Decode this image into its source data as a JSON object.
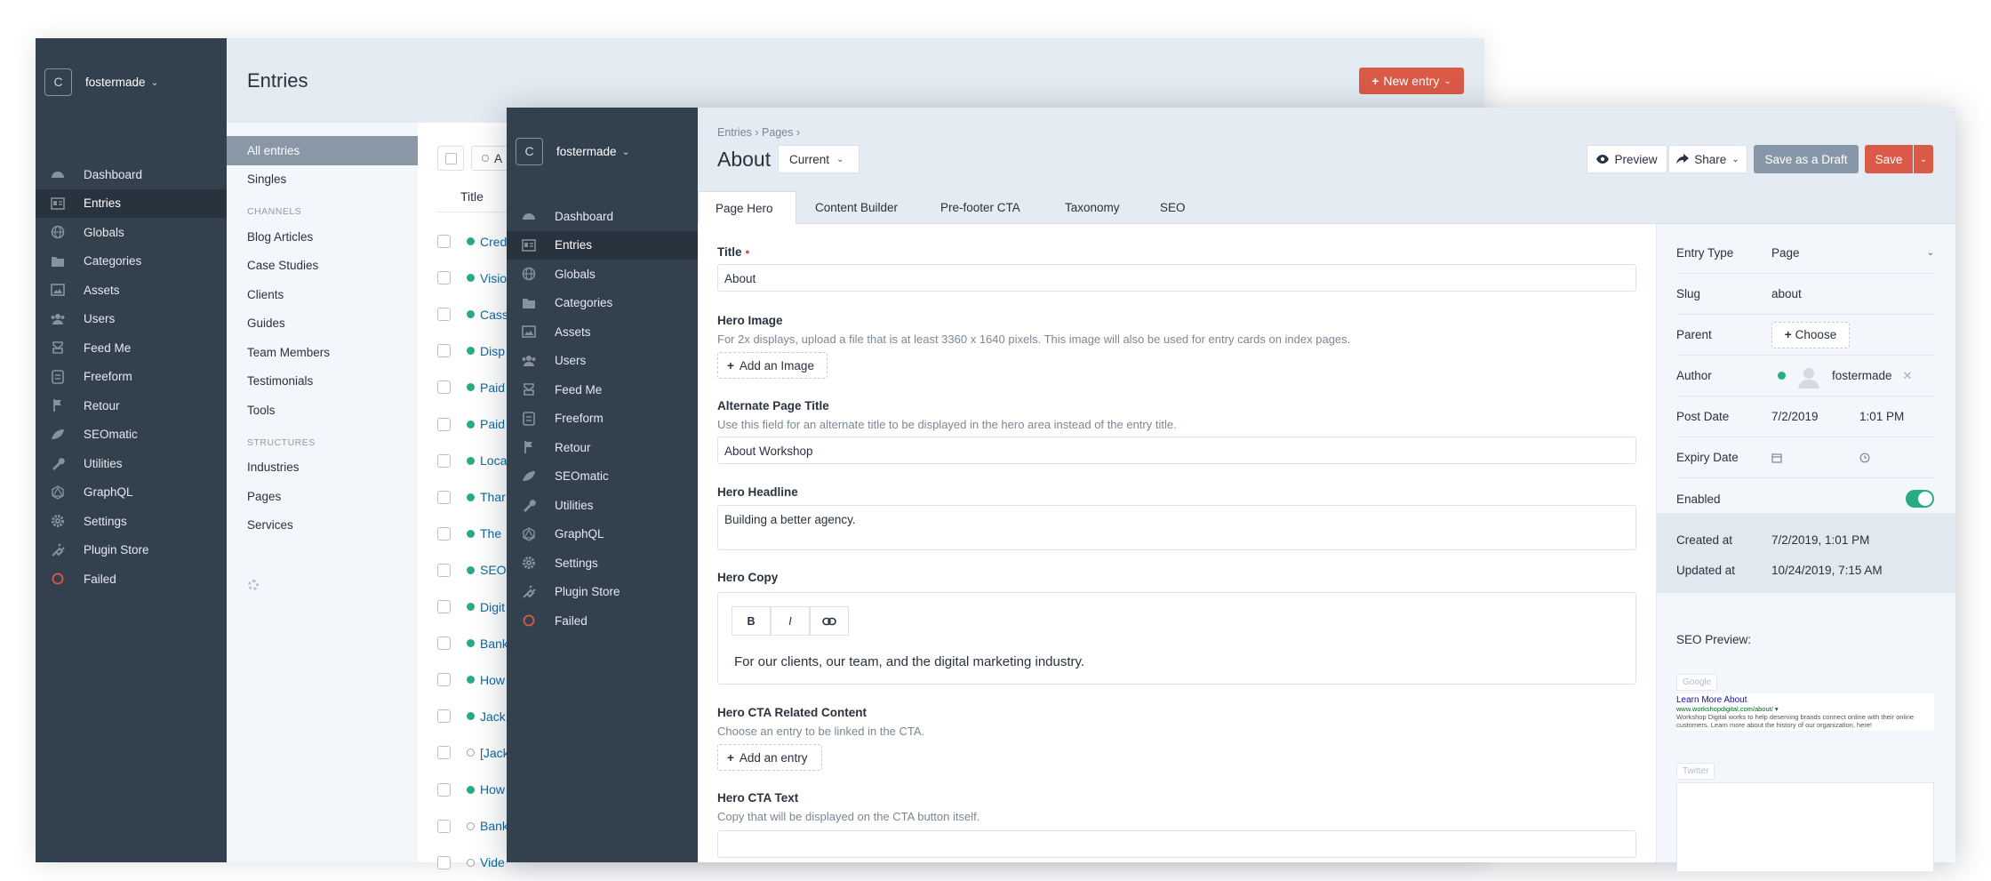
{
  "back_window": {
    "site_name": "fostermade",
    "logo_letter": "C",
    "page_title": "Entries",
    "new_entry_label": "New entry",
    "nav": [
      "Dashboard",
      "Entries",
      "Globals",
      "Categories",
      "Assets",
      "Users",
      "Feed Me",
      "Freeform",
      "Retour",
      "SEOmatic",
      "Utilities",
      "GraphQL",
      "Settings",
      "Plugin Store",
      "Failed"
    ],
    "active_nav": "Entries",
    "sources": {
      "all_entries": "All entries",
      "singles": "Singles",
      "channels_heading": "CHANNELS",
      "channels": [
        "Blog Articles",
        "Case Studies",
        "Clients",
        "Guides",
        "Team Members",
        "Testimonials",
        "Tools"
      ],
      "structures_heading": "STRUCTURES",
      "structures": [
        "Industries",
        "Pages",
        "Services"
      ]
    },
    "list": {
      "column_title": "Title",
      "toolbar_fragment": "A",
      "rows": [
        {
          "title": "Cred",
          "status": "enabled"
        },
        {
          "title": "Visio",
          "status": "enabled"
        },
        {
          "title": "Cass",
          "status": "enabled"
        },
        {
          "title": "Disp",
          "status": "enabled"
        },
        {
          "title": "Paid",
          "status": "enabled"
        },
        {
          "title": "Paid",
          "status": "enabled"
        },
        {
          "title": "Loca",
          "status": "enabled"
        },
        {
          "title": "Thar",
          "status": "enabled"
        },
        {
          "title": "The",
          "status": "enabled"
        },
        {
          "title": "SEO",
          "status": "enabled"
        },
        {
          "title": "Digit",
          "status": "enabled"
        },
        {
          "title": "Bank",
          "status": "enabled"
        },
        {
          "title": "How",
          "status": "enabled"
        },
        {
          "title": "Jack",
          "status": "enabled"
        },
        {
          "title": "[Jack",
          "status": "disabled"
        },
        {
          "title": "How",
          "status": "enabled"
        },
        {
          "title": "Bank",
          "status": "disabled"
        },
        {
          "title": "Vide",
          "status": "disabled"
        }
      ]
    }
  },
  "front_window": {
    "site_name": "fostermade",
    "logo_letter": "C",
    "nav": [
      "Dashboard",
      "Entries",
      "Globals",
      "Categories",
      "Assets",
      "Users",
      "Feed Me",
      "Freeform",
      "Retour",
      "SEOmatic",
      "Utilities",
      "GraphQL",
      "Settings",
      "Plugin Store",
      "Failed"
    ],
    "active_nav": "Entries",
    "breadcrumbs": "Entries › Pages ›",
    "page_title": "About",
    "revision": "Current",
    "buttons": {
      "preview": "Preview",
      "share": "Share",
      "draft": "Save as a Draft",
      "save": "Save"
    },
    "tabs": [
      "Page Hero",
      "Content Builder",
      "Pre-footer CTA",
      "Taxonomy",
      "SEO"
    ],
    "active_tab": "Page Hero",
    "fields": {
      "title_label": "Title",
      "title_value": "About",
      "hero_image_label": "Hero Image",
      "hero_image_instr": "For 2x displays, upload a file that is at least 3360 x 1640 pixels. This image will also be used for entry cards on index pages.",
      "hero_image_button": "Add an Image",
      "alt_title_label": "Alternate Page Title",
      "alt_title_instr": "Use this field for an alternate title to be displayed in the hero area instead of the entry title.",
      "alt_title_value": "About Workshop",
      "headline_label": "Hero Headline",
      "headline_value": "Building a better agency.",
      "copy_label": "Hero Copy",
      "copy_bold": "B",
      "copy_italic": "I",
      "copy_value": "For our clients, our team, and the digital marketing industry.",
      "cta_related_label": "Hero CTA Related Content",
      "cta_related_instr": "Choose an entry to be linked in the CTA.",
      "cta_related_button": "Add an entry",
      "cta_text_label": "Hero CTA Text",
      "cta_text_instr": "Copy that will be displayed on the CTA button itself."
    },
    "meta": {
      "entry_type_label": "Entry Type",
      "entry_type_value": "Page",
      "slug_label": "Slug",
      "slug_value": "about",
      "parent_label": "Parent",
      "parent_button": "Choose",
      "author_label": "Author",
      "author_value": "fostermade",
      "post_date_label": "Post Date",
      "post_date_value": "7/2/2019",
      "post_time_value": "1:01 PM",
      "expiry_label": "Expiry Date",
      "enabled_label": "Enabled",
      "enabled": true,
      "created_label": "Created at",
      "created_value": "7/2/2019, 1:01 PM",
      "updated_label": "Updated at",
      "updated_value": "10/24/2019, 7:15 AM"
    },
    "seo": {
      "heading": "SEO Preview:",
      "google_tag": "Google",
      "google_title": "Learn More About",
      "google_url": "www.workshopdigital.com/about/",
      "google_desc": "Workshop Digital works to help deserving brands connect online with their online customers. Learn more about the history of our organization, here!",
      "twitter_tag": "Twitter"
    }
  },
  "colors": {
    "sidebar": "#33404d",
    "accent": "#da5a47",
    "link": "#0b69a3",
    "status_green": "#27ab83",
    "header_bg": "#e4ebf2"
  }
}
